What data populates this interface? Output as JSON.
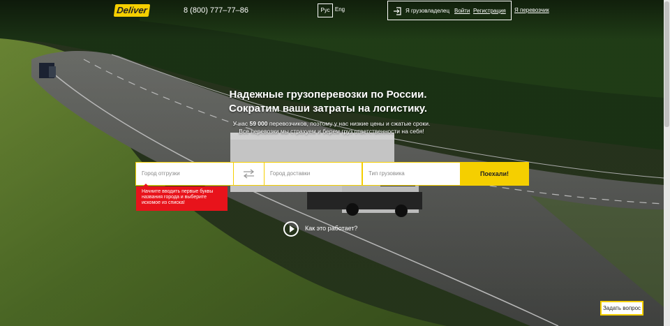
{
  "header": {
    "logo_text": "Deliver",
    "phone": "8 (800) 777–77–86",
    "lang_active": "Рус",
    "lang_other": "Eng",
    "owner_label": "Я грузовладелец",
    "login_link": "Войти",
    "register_link": "Регистрация",
    "carrier_link": "Я перевозчик"
  },
  "hero": {
    "title_line1": "Надежные грузоперевозки по России.",
    "title_line2": "Сократим ваши затраты на логистику.",
    "sub_prefix": "У нас ",
    "sub_count": "59 000",
    "sub_suffix": " перевозчиков, поэтому у нас низкие цены и сжатые сроки.",
    "sub_line2": "Все перевозки мы страхуем и берем груз ответственности на себя!"
  },
  "search": {
    "from_placeholder": "Город отгрузки",
    "to_placeholder": "Город доставки",
    "type_placeholder": "Тип грузовика",
    "submit_label": "Поехали!",
    "hint": "Начните вводить первые буквы названия города и выберите искомое из списка!"
  },
  "how": {
    "label": "Как это работает?"
  },
  "ask": {
    "label": "Задать вопрос"
  },
  "colors": {
    "accent": "#f5cf00",
    "hint_bg": "#e8131b"
  },
  "icons": [
    "login-icon",
    "swap-arrows-icon",
    "play-icon"
  ]
}
